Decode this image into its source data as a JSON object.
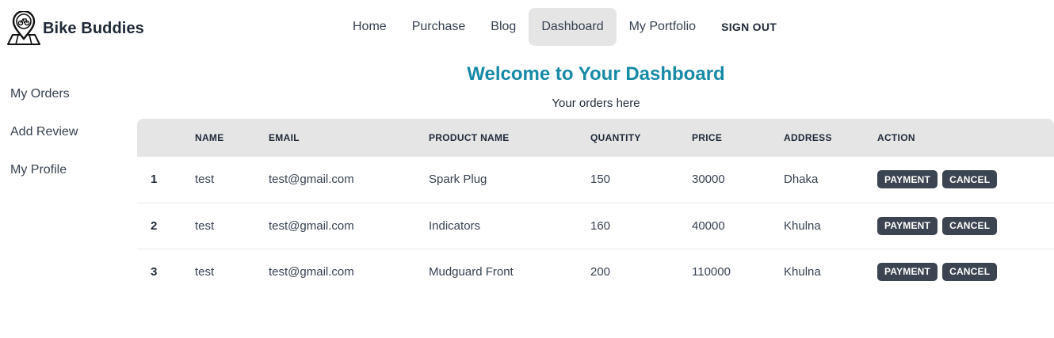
{
  "brand": {
    "name": "Bike Buddies",
    "logo_icon": "bike-map-pin-icon"
  },
  "nav": {
    "items": [
      {
        "label": "Home"
      },
      {
        "label": "Purchase"
      },
      {
        "label": "Blog"
      },
      {
        "label": "Dashboard",
        "active": true
      },
      {
        "label": "My Portfolio"
      }
    ],
    "signout_label": "SIGN OUT"
  },
  "sidebar": {
    "items": [
      {
        "label": "My Orders"
      },
      {
        "label": "Add Review"
      },
      {
        "label": "My Profile"
      }
    ]
  },
  "main": {
    "title": "Welcome to Your Dashboard",
    "subtitle": "Your orders here"
  },
  "table": {
    "columns": [
      "",
      "NAME",
      "EMAIL",
      "PRODUCT NAME",
      "QUANTITY",
      "PRICE",
      "ADDRESS",
      "ACTION"
    ],
    "rows": [
      {
        "index": "1",
        "name": "test",
        "email": "test@gmail.com",
        "product": "Spark Plug",
        "quantity": "150",
        "price": "30000",
        "address": "Dhaka",
        "payment_label": "PAYMENT",
        "cancel_label": "CANCEL"
      },
      {
        "index": "2",
        "name": "test",
        "email": "test@gmail.com",
        "product": "Indicators",
        "quantity": "160",
        "price": "40000",
        "address": "Khulna",
        "payment_label": "PAYMENT",
        "cancel_label": "CANCEL"
      },
      {
        "index": "3",
        "name": "test",
        "email": "test@gmail.com",
        "product": "Mudguard Front",
        "quantity": "200",
        "price": "110000",
        "address": "Khulna",
        "payment_label": "PAYMENT",
        "cancel_label": "CANCEL"
      }
    ]
  },
  "colors": {
    "title": "#168aa6",
    "button": "#3d4451",
    "header_row": "#e5e5e5",
    "active_nav": "#e5e5e5"
  }
}
